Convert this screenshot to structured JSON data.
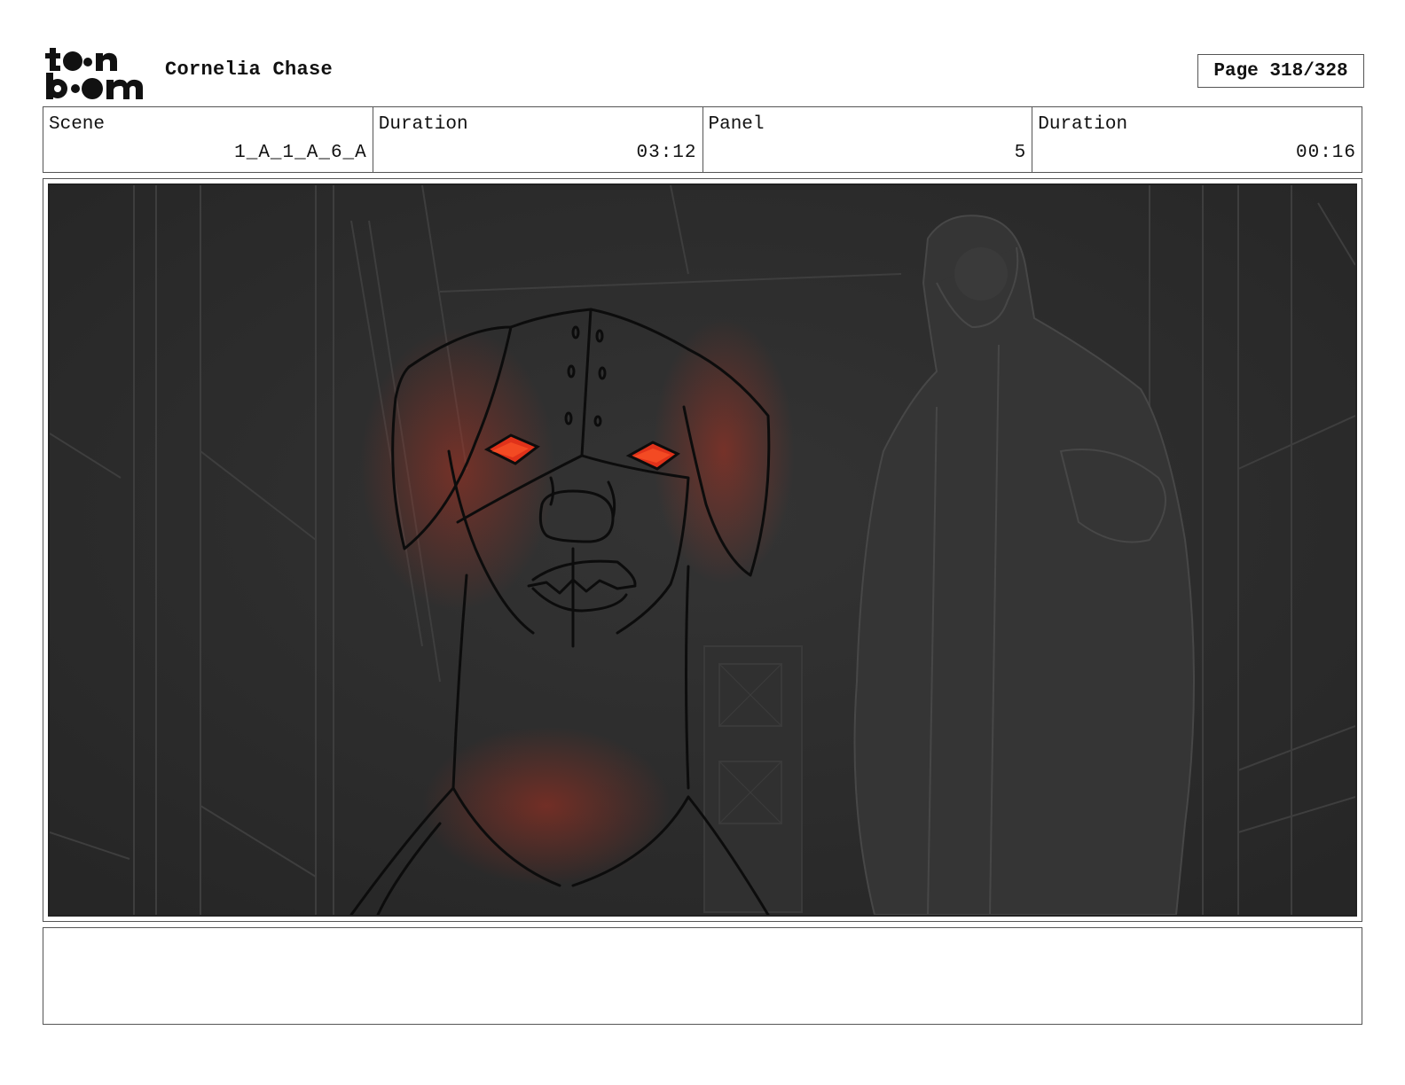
{
  "header": {
    "logo_text": "toon boom",
    "project_title": "Cornelia Chase",
    "page_label": "Page 318/328"
  },
  "info": {
    "scene_label": "Scene",
    "scene_value": "1_A_1_A_6_A",
    "scene_duration_label": "Duration",
    "scene_duration_value": "03:12",
    "panel_label": "Panel",
    "panel_value": "5",
    "panel_duration_label": "Duration",
    "panel_duration_value": "00:16"
  },
  "colors": {
    "eye_glow": "#e0321a",
    "background_dark": "#2c2c2c"
  },
  "notes": {
    "text": ""
  }
}
